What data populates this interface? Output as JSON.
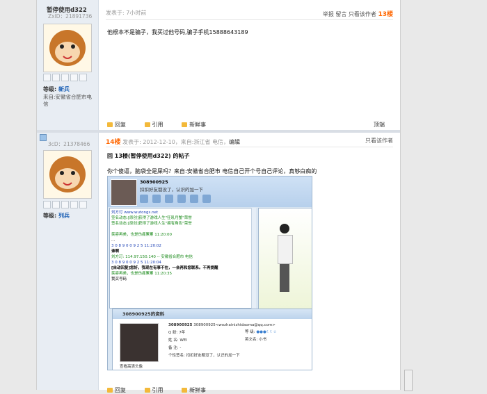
{
  "post1": {
    "username": "暂停使用d322",
    "uid": "ZxID：21891736",
    "grade_label": "等级:",
    "grade_value": "新兵",
    "from": "来自:安徽省合肥市电信",
    "posted": "发表于: 7小时前",
    "actions_right": [
      "举报",
      "留言",
      "只看该作者"
    ],
    "floor": "13楼",
    "content": "他根本不是骗子，我买过他号码,骗子手机15888643189",
    "footer_actions": [
      "回复",
      "引用",
      "新鲜事"
    ],
    "top_link": "顶端"
  },
  "post2": {
    "uid_prefix": "3cD：",
    "uid": "21378466",
    "grade_label": "等级:",
    "grade_value": "列兵",
    "floor": "14楼",
    "posted": "发表于: 2012-12-10，来自:浙江省 电信，",
    "edit": "编辑",
    "actions_right": "只看该作者",
    "reply_title": "回 13楼(暂停使用d322) 的帖子",
    "content": "你个傻逼，脑袋全是屎吗？来自:安徽省合肥市 电信自己开个号自己评论，真够白痴的",
    "screenshot": {
      "qq_name": "308900925",
      "qq_sig": "扣扣好友都没了，认识的加一下",
      "chat_lines": [
        {
          "cls": "b",
          "text": "刘方玎  www.wutongs.net"
        },
        {
          "cls": "g",
          "text": "签名动态:[原创]获得了游戏人生\"狂吼月蟹\"荣誉"
        },
        {
          "cls": "g",
          "text": "签名动态:[原创]获得了游戏人生\"拥有角色\"荣誉"
        },
        {
          "cls": "k",
          "text": ""
        },
        {
          "cls": "g",
          "text": "笑容再美，也是伤痛累累   11:20:00"
        },
        {
          "cls": "k",
          "text": "  ..."
        },
        {
          "cls": "b",
          "text": "3 0 8 9 0 0 9 2 5   11:20:02"
        },
        {
          "cls": "k bold",
          "text": "谁啊"
        },
        {
          "cls": "g",
          "text": "刘方玎: 114.97.150.140 -- 安徽省合肥市 电信"
        },
        {
          "cls": "b",
          "text": "3 0 8 9 0 0 9 2 5   11:20:04"
        },
        {
          "cls": "k bold",
          "text": "[自动回复]您好，我现在有事不在，一会再和您联系。不再提醒"
        },
        {
          "cls": "g",
          "text": "笑容再美，也是伤痛累累   11:20:35"
        },
        {
          "cls": "k",
          "text": "我买号码"
        }
      ],
      "profile_title": "308900925的资料",
      "profile_name": "308900925",
      "profile_email": "308900925<wozhainizhidaoma@qq.com>",
      "qq_label": "Q  龄:",
      "qq_age": "7年",
      "level_label": "等  级:",
      "name_label": "姓  名:",
      "name_value": "WEI",
      "en_label": "英文名:",
      "en_value": "小书",
      "note_label": "备  注:",
      "note_value": "-",
      "sig_label": "个性签名:",
      "sig_value": "扣扣好友都没了，认识的加一下",
      "view_head": "查看高清头像"
    },
    "footer_actions": [
      "回复",
      "引用",
      "新鲜事"
    ]
  },
  "colors": {
    "accent_floor": "#ff6600",
    "grade": "#1a5fb4"
  }
}
